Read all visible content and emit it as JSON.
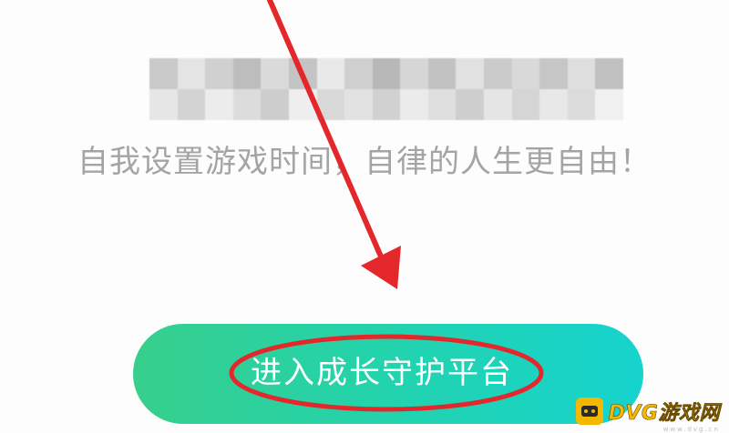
{
  "subtitle": "自我设置游戏时间，自律的人生更自由！",
  "enter_button": {
    "label": "进入成长守护平台"
  },
  "watermark": {
    "brand": "DVG游戏网",
    "sub": "www.dvg.cn"
  },
  "colors": {
    "button_gradient_start": "#37cf8c",
    "button_gradient_end": "#16d3ce",
    "annotation_red": "#e3272b",
    "subtitle": "#a4a4a4"
  },
  "icons": [
    "redacted-title-mosaic",
    "annotation-arrow",
    "annotation-ellipse",
    "dvg-logo-icon"
  ]
}
